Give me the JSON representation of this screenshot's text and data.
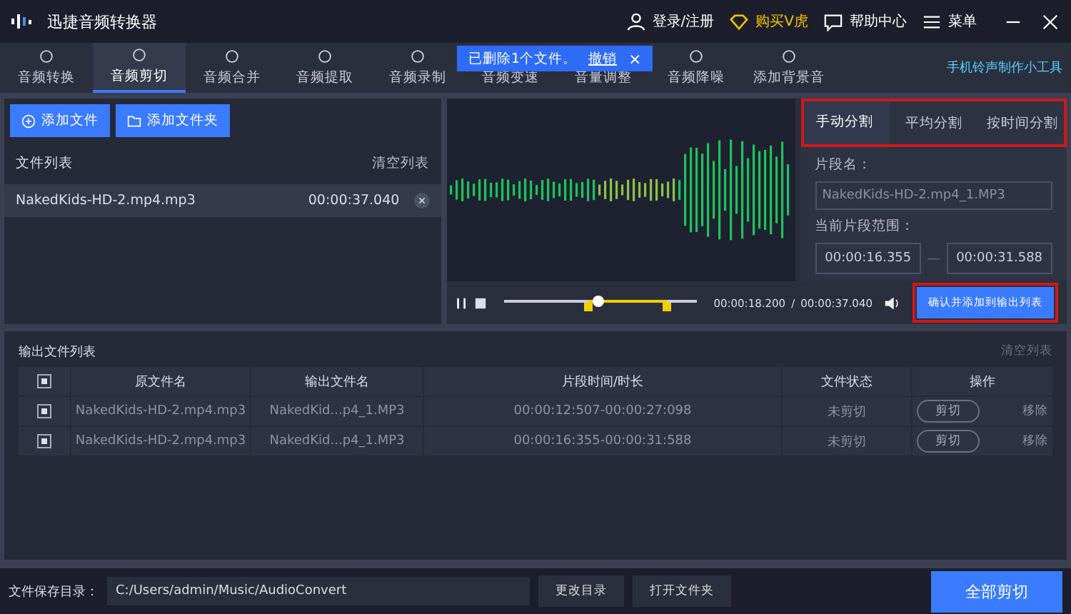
{
  "app": {
    "title": "迅捷音频转换器",
    "login": "登录/注册",
    "buy_vip": "购买V虎",
    "help": "帮助中心",
    "menu": "菜单"
  },
  "nav": {
    "tabs": [
      {
        "label": "音频转换",
        "selected": false
      },
      {
        "label": "音频剪切",
        "selected": true
      },
      {
        "label": "音频合并",
        "selected": false
      },
      {
        "label": "音频提取",
        "selected": false
      },
      {
        "label": "音频录制",
        "selected": false
      },
      {
        "label": "音频变速",
        "selected": false
      },
      {
        "label": "音量调整",
        "selected": false
      },
      {
        "label": "音频降噪",
        "selected": false
      },
      {
        "label": "添加背景音",
        "selected": false
      }
    ],
    "ringtone_tool": "手机铃声制作小工具"
  },
  "toast": {
    "message": "已删除1个文件。",
    "undo": "撤销",
    "close": "×"
  },
  "file_panel": {
    "add_file": "添加文件",
    "add_folder": "添加文件夹",
    "list_title": "文件列表",
    "clear": "清空列表",
    "files": [
      {
        "name": "NakedKids-HD-2.mp4.mp3",
        "duration": "00:00:37.040",
        "selected": true
      }
    ]
  },
  "player": {
    "current": "00:00:18.200",
    "separator": "/",
    "total": "00:00:37.040",
    "level": 0.49,
    "range": [
      {
        "level": 0.44
      },
      {
        "level": 0.85
      }
    ]
  },
  "split": {
    "tabs": [
      {
        "label": "手动分割",
        "selected": true
      },
      {
        "label": "平均分割",
        "selected": false
      },
      {
        "label": "按时间分割",
        "selected": false
      }
    ],
    "segment_label": "片段名：",
    "segment_placeholder": "NakedKids-HD-2.mp4_1.MP3",
    "range_label": "当前片段范围：",
    "range_start": "00:00:16.355",
    "range_dash": "—",
    "range_end": "00:00:31.588",
    "confirm": "确认并添加到输出列表"
  },
  "output": {
    "title": "输出文件列表",
    "clear": "清空列表",
    "columns": [
      "原文件名",
      "输出文件名",
      "片段时间/时长",
      "文件状态",
      "操作"
    ],
    "all_checked": true,
    "rows": [
      {
        "checked": true,
        "source": "NakedKids-HD-2.mp4.mp3",
        "output": "NakedKid...p4_1.MP3",
        "time": "00:00:12:507-00:00:27:098",
        "status": "未剪切",
        "cut": "剪切",
        "remove": "移除"
      },
      {
        "checked": true,
        "source": "NakedKids-HD-2.mp4.mp3",
        "output": "NakedKid...p4_1.MP3",
        "time": "00:00:16:355-00:00:31:588",
        "status": "未剪切",
        "cut": "剪切",
        "remove": "移除"
      }
    ]
  },
  "footer": {
    "save_label": "文件保存目录：",
    "save_path": "C:/Users/admin/Music/AudioConvert",
    "change_dir": "更改目录",
    "open_folder": "打开文件夹",
    "cut_all": "全部剪切"
  }
}
